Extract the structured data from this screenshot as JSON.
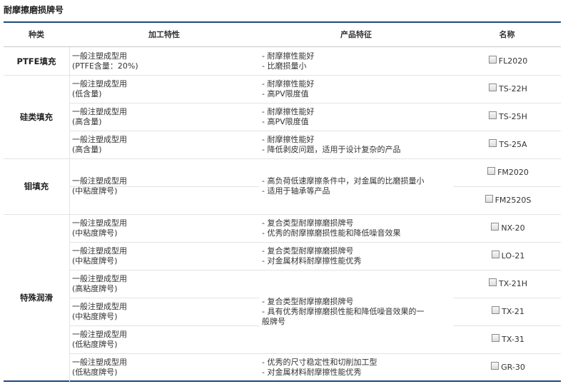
{
  "title": "耐摩擦磨损牌号",
  "headers": {
    "category": "种类",
    "processing": "加工特性",
    "features": "产品特征",
    "name": "名称"
  },
  "categories": [
    "PTFE填充",
    "硅类填充",
    "钼填充",
    "特殊润滑"
  ],
  "rows": [
    {
      "proc": [
        "一般注塑成型用",
        "(PTFE含量：20%)"
      ],
      "feat": [
        "- 耐摩擦性能好",
        "- 比磨损量小"
      ],
      "name": "FL2020"
    },
    {
      "proc": [
        "一般注塑成型用",
        "(低含量)"
      ],
      "feat": [
        "- 耐摩擦性能好",
        "- 高PV限度值"
      ],
      "name": "TS-22H"
    },
    {
      "proc": [
        "一般注塑成型用",
        "(高含量)"
      ],
      "feat": [
        "- 耐摩擦性能好",
        "- 高PV限度值"
      ],
      "name": "TS-25H"
    },
    {
      "proc": [
        "一般注塑成型用",
        "(高含量)"
      ],
      "feat": [
        "- 耐摩擦性能好",
        "- 降低剥皮问题，适用于设计复杂的产品"
      ],
      "name": "TS-25A"
    },
    {
      "name": "FM2020"
    },
    {
      "name": "FM2520S"
    },
    {
      "proc": [
        "一般注塑成型用",
        "(中粘度牌号)"
      ],
      "feat": [
        "- 复合类型耐摩擦磨损牌号",
        "- 优秀的耐摩擦磨损性能和降低噪音效果"
      ],
      "name": "NX-20"
    },
    {
      "proc": [
        "一般注塑成型用",
        "(中粘度牌号)"
      ],
      "feat": [
        "- 复合类型耐摩擦磨损牌号",
        "- 对金属材料耐摩擦性能优秀"
      ],
      "name": "LO-21"
    },
    {
      "proc": [
        "一般注塑成型用",
        "(高粘度牌号)"
      ],
      "name": "TX-21H"
    },
    {
      "proc": [
        "一般注塑成型用",
        "(中粘度牌号)"
      ],
      "name": "TX-21"
    },
    {
      "proc": [
        "一般注塑成型用",
        "(低粘度牌号)"
      ],
      "name": "TX-31"
    },
    {
      "proc": [
        "一般注塑成型用",
        "(低粘度牌号)"
      ],
      "feat": [
        "- 优秀的尺寸稳定性和切削加工型",
        "- 对金属材料耐摩擦性能优秀"
      ],
      "name": "GR-30"
    }
  ],
  "merged": {
    "moly": {
      "proc": [
        "一般注塑成型用",
        "(中粘度牌号)"
      ],
      "feat": [
        "- 高负荷低速摩擦条件中，对金属的比磨损量小",
        "- 适用于轴承等产品"
      ]
    },
    "tx": {
      "feat": [
        "- 复合类型耐摩擦磨损牌号",
        "- 具有优秀耐摩擦磨损性能和降低噪音效果的一",
        "般牌号"
      ]
    }
  }
}
